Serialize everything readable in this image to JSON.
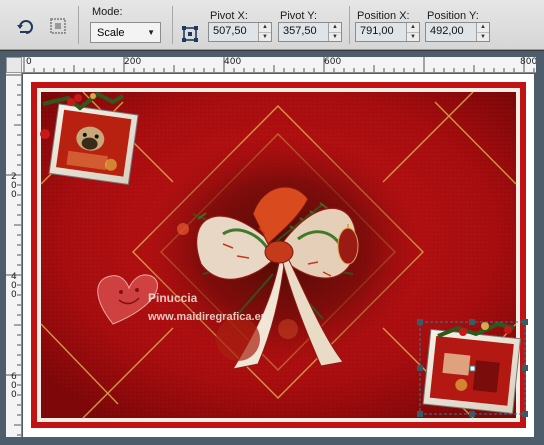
{
  "toolbar": {
    "mode_label": "Mode:",
    "mode_value": "Scale",
    "pivot_x_label": "Pivot X:",
    "pivot_x_value": "507,50",
    "pivot_y_label": "Pivot Y:",
    "pivot_y_value": "357,50",
    "position_x_label": "Position X:",
    "position_x_value": "791,00",
    "position_y_label": "Position Y:",
    "position_y_value": "492,00"
  },
  "rulers": {
    "top": [
      "0",
      "200",
      "400",
      "600",
      "800"
    ],
    "left": [
      "200",
      "400",
      "600"
    ]
  },
  "canvas": {
    "watermark_line1": "Pinuccia",
    "watermark_line2": "www.maidiregrafica.eu"
  },
  "colors": {
    "card_red": "#b40d10",
    "dark_red": "#7d0508",
    "gold": "#d8a84a",
    "selection": "#2a7f8f"
  }
}
